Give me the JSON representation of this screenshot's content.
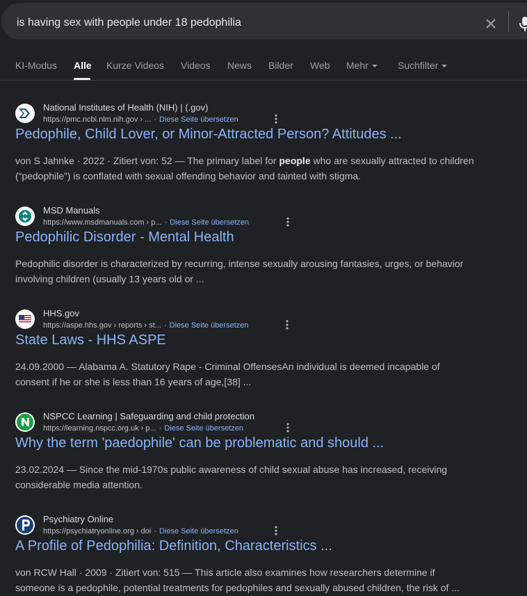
{
  "search": {
    "query": "is having sex with people under 18 pedophilia"
  },
  "tabs": [
    {
      "label": "KI-Modus"
    },
    {
      "label": "Alle"
    },
    {
      "label": "Kurze Videos"
    },
    {
      "label": "Videos"
    },
    {
      "label": "News"
    },
    {
      "label": "Bilder"
    },
    {
      "label": "Web"
    },
    {
      "label": "Mehr"
    },
    {
      "label": "Suchfilter"
    }
  ],
  "translate_label": "Diese Seite übersetzen",
  "results": [
    {
      "site": "National Institutes of Health (NIH) | (.gov)",
      "url": "https://pmc.ncbi.nlm.nih.gov › ...",
      "title": "Pedophile, Child Lover, or Minor-Attracted Person? Attitudes ...",
      "snippet_pre": "von S Jahnke · 2022 · Zitiert von: 52 — The primary label for ",
      "snippet_bold": "people",
      "snippet_post": " who are sexually attracted to children (“pedophile”) is conflated with sexual offending behavior and tainted with stigma.",
      "icon": "nih-icon"
    },
    {
      "site": "MSD Manuals",
      "url": "https://www.msdmanuals.com › p...",
      "title": "Pedophilic Disorder - Mental Health",
      "snippet": "Pedophilic disorder is characterized by recurring, intense sexually arousing fantasies, urges, or behavior involving children (usually 13 years old or ...",
      "icon": "msd-icon"
    },
    {
      "site": "HHS.gov",
      "url": "https://aspe.hhs.gov › reports › st...",
      "title": "State Laws - HHS ASPE",
      "snippet": "24.09.2000 — Alabama A. Statutory Rape - Criminal OffensesAn individual is deemed incapable of consent if he or she is less than 16 years of age,[38] ...",
      "icon": "us-flag-icon"
    },
    {
      "site": "NSPCC Learning | Safeguarding and child protection",
      "url": "https://learning.nspcc.org.uk › p...",
      "title": "Why the term 'paedophile' can be problematic and should ...",
      "snippet": "23.02.2024 — Since the mid-1970s public awareness of child sexual abuse has increased, receiving considerable media attention.",
      "icon": "nspcc-icon"
    },
    {
      "site": "Psychiatry Online",
      "url": "https://psychiatryonline.org › doi",
      "title": "A Profile of Pedophilia: Definition, Characteristics ...",
      "snippet": "von RCW Hall · 2009 · Zitiert von: 515 — This article also examines how researchers determine if someone is a pedophile, potential treatments for pedophiles and sexually abused children, the risk of ...",
      "icon": "psychiatry-online-icon"
    }
  ]
}
